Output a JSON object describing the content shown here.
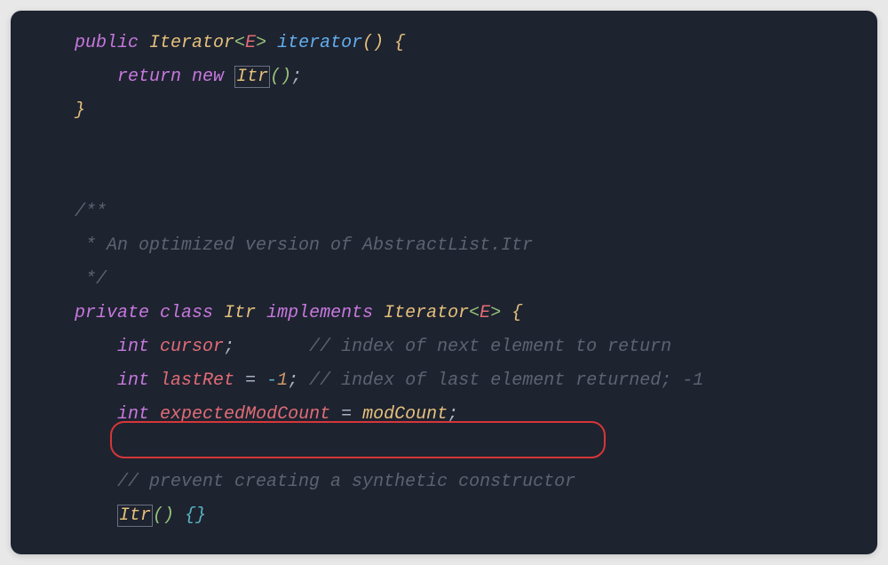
{
  "code": {
    "line1": {
      "public": "public",
      "iterator_type": "Iterator",
      "type_param": "E",
      "method": "iterator",
      "parens": "()",
      "brace_open": "{"
    },
    "line2": {
      "return": "return",
      "new": "new",
      "itr": "Itr",
      "parens": "()",
      "semi": ";"
    },
    "line3": {
      "brace_close": "}"
    },
    "comment_block": {
      "start": "/**",
      "body": " * An optimized version of AbstractList.Itr",
      "end": " */"
    },
    "line_class": {
      "private": "private",
      "class": "class",
      "itr": "Itr",
      "implements": "implements",
      "iterator_type": "Iterator",
      "type_param": "E",
      "brace_open": "{"
    },
    "line_cursor": {
      "int": "int",
      "field": "cursor",
      "semi": ";",
      "comment": "// index of next element to return"
    },
    "line_lastret": {
      "int": "int",
      "field": "lastRet",
      "eq": "=",
      "minus": "-",
      "one": "1",
      "semi": ";",
      "comment": "// index of last element returned; -1"
    },
    "line_expected": {
      "int": "int",
      "field": "expectedModCount",
      "eq": "=",
      "modcount": "modCount",
      "semi": ";"
    },
    "line_prevent": {
      "comment": "// prevent creating a synthetic constructor"
    },
    "line_ctor": {
      "itr": "Itr",
      "parens": "()",
      "braces": "{}"
    }
  }
}
